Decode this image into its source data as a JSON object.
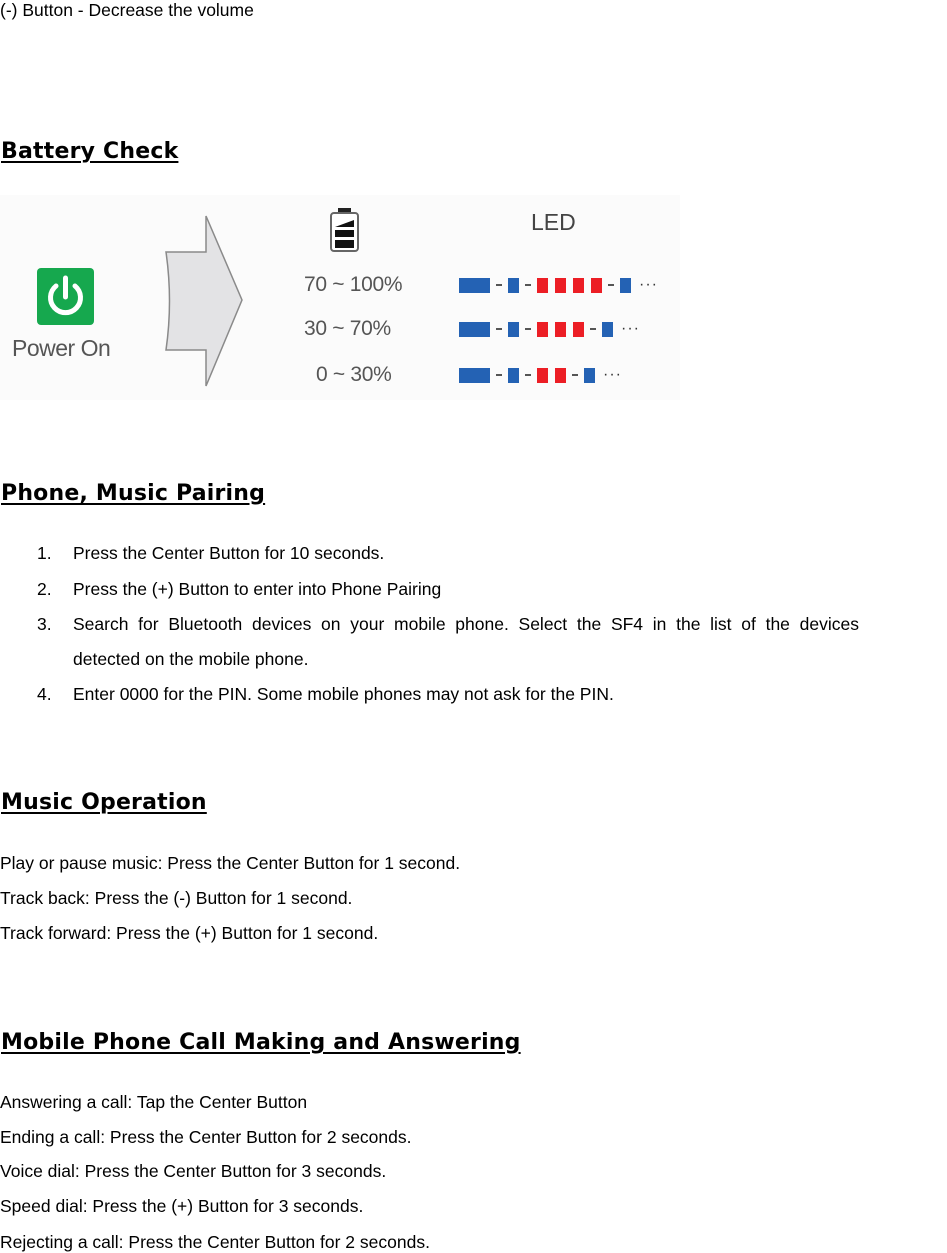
{
  "intro_line": "(-) Button -  Decrease the volume",
  "battery_check": {
    "heading": "Battery Check",
    "figure": {
      "power_label": "Power On",
      "power_icon": "power-icon",
      "arrow_icon": "arrow-right-icon",
      "battery_icon": "battery-icon",
      "led_title": "LED",
      "colors": {
        "blue": "#2462b4",
        "red": "#ec1e25",
        "power_green": "#16a84e"
      },
      "levels": [
        {
          "range": "70 ~ 100%",
          "red_count": 4,
          "trail": "···"
        },
        {
          "range": "30 ~ 70%",
          "red_count": 3,
          "trail": "···"
        },
        {
          "range": "0 ~ 30%",
          "red_count": 2,
          "trail": "···"
        }
      ]
    }
  },
  "pairing": {
    "heading": "Phone, Music Pairing",
    "steps": [
      {
        "num": "1.",
        "text": "Press the Center Button for 10 seconds."
      },
      {
        "num": "2.",
        "text": "Press the (+) Button to enter into Phone Pairing"
      },
      {
        "num": "3.",
        "text_line1": "Search  for  Bluetooth  devices  on  your  mobile  phone.  Select  the  SF4  in  the  list  of  the  devices",
        "text_line2": "detected on the mobile phone."
      },
      {
        "num": "4.",
        "text": "Enter 0000 for the PIN. Some mobile phones may not ask for the PIN."
      }
    ]
  },
  "music": {
    "heading": "Music Operation",
    "lines": [
      "Play or pause music: Press the Center Button for 1 second.",
      "Track back: Press the (-) Button for 1 second.",
      "Track forward: Press the (+) Button for 1 second."
    ]
  },
  "calls": {
    "heading": "Mobile Phone Call Making and Answering",
    "lines": [
      "Answering a call: Tap the Center Button",
      "Ending a call: Press the Center Button for 2 seconds.",
      "Voice dial: Press the Center Button for 3 seconds.",
      "Speed dial: Press the (+) Button for 3 seconds.",
      "Rejecting a call: Press the Center Button for 2 seconds."
    ]
  }
}
